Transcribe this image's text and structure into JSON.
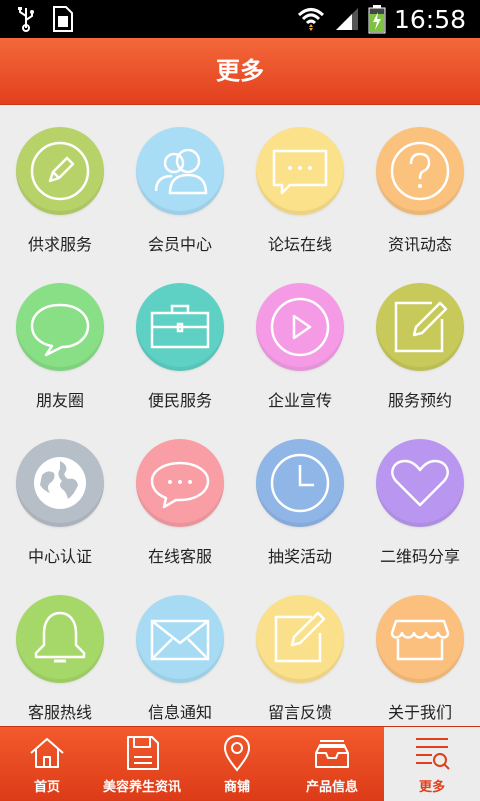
{
  "status_bar": {
    "time": "16:58"
  },
  "header": {
    "title": "更多"
  },
  "grid": [
    {
      "label": "供求服务",
      "icon": "pencil-icon",
      "color": "#b8d26a"
    },
    {
      "label": "会员中心",
      "icon": "users-icon",
      "color": "#a9dcf5"
    },
    {
      "label": "论坛在线",
      "icon": "chat-bubble-icon",
      "color": "#fbe18a"
    },
    {
      "label": "资讯动态",
      "icon": "question-icon",
      "color": "#fbc27e"
    },
    {
      "label": "朋友圈",
      "icon": "speech-bubble-icon",
      "color": "#88df86"
    },
    {
      "label": "便民服务",
      "icon": "briefcase-icon",
      "color": "#5ed1c4"
    },
    {
      "label": "企业宣传",
      "icon": "play-icon",
      "color": "#f59be6"
    },
    {
      "label": "服务预约",
      "icon": "edit-icon",
      "color": "#c7c95b"
    },
    {
      "label": "中心认证",
      "icon": "globe-icon",
      "color": "#b6bec8"
    },
    {
      "label": "在线客服",
      "icon": "chat-dots-icon",
      "color": "#f89ea4"
    },
    {
      "label": "抽奖活动",
      "icon": "clock-icon",
      "color": "#8fb6e7"
    },
    {
      "label": "二维码分享",
      "icon": "heart-icon",
      "color": "#b997f0"
    },
    {
      "label": "客服热线",
      "icon": "bell-icon",
      "color": "#a5d868"
    },
    {
      "label": "信息通知",
      "icon": "mail-icon",
      "color": "#a7dbf3"
    },
    {
      "label": "留言反馈",
      "icon": "note-icon",
      "color": "#fbe08b"
    },
    {
      "label": "关于我们",
      "icon": "store-icon",
      "color": "#fbc07d"
    }
  ],
  "nav": [
    {
      "label": "首页",
      "icon": "home-icon",
      "active": false
    },
    {
      "label": "美容养生资讯",
      "icon": "save-icon",
      "active": false
    },
    {
      "label": "商铺",
      "icon": "location-pin-icon",
      "active": false
    },
    {
      "label": "产品信息",
      "icon": "inbox-icon",
      "active": false
    },
    {
      "label": "更多",
      "icon": "more-search-icon",
      "active": true
    }
  ]
}
